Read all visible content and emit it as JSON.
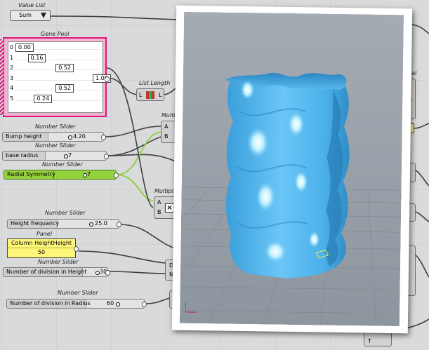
{
  "value_list": {
    "caption": "Value List",
    "selected": "Sum"
  },
  "gene_pool": {
    "caption": "Gene Pool",
    "genes": [
      {
        "index": "0",
        "value": "0.00",
        "fraction": 0.0
      },
      {
        "index": "1",
        "value": "0.16",
        "fraction": 0.16
      },
      {
        "index": "2",
        "value": "0.52",
        "fraction": 0.52
      },
      {
        "index": "3",
        "value": "1.00",
        "fraction": 1.0
      },
      {
        "index": "4",
        "value": "0.52",
        "fraction": 0.52
      },
      {
        "index": "5",
        "value": "0.24",
        "fraction": 0.24
      }
    ]
  },
  "list_length": {
    "caption": "List Length",
    "input": "L",
    "output": "L"
  },
  "multiplication_1": {
    "caption": "Multipli",
    "inputs": [
      "A",
      "B"
    ]
  },
  "multiplication_2": {
    "caption": "Multiplic",
    "inputs": [
      "A",
      "B"
    ]
  },
  "sliders": [
    {
      "caption": "Number Slider",
      "name": "Bump height",
      "value": "4.20",
      "color": "grey"
    },
    {
      "caption": "Number Slider",
      "name": "base radius",
      "value": "7",
      "color": "grey"
    },
    {
      "caption": "Number Slider",
      "name": "Radial Symmetry",
      "value": "7",
      "color": "green"
    },
    {
      "caption": "Number Slider",
      "name": "Height frequancy",
      "value": "25.0",
      "color": "grey"
    },
    {
      "caption": "Number Slider",
      "name": "Number of division in Height",
      "value": "30",
      "color": "grey"
    },
    {
      "caption": "Number Slider",
      "name": "Number of division in Radius",
      "value": "60",
      "color": "grey"
    }
  ],
  "panel": {
    "caption": "Panel",
    "title": "Column HeightHeight",
    "value": "50"
  },
  "right_side": {
    "cylindrical_caption": "ndrical",
    "pt_port": "Pt",
    "mesh_caption": "esh"
  },
  "ports_lower": {
    "d": "D",
    "n": "N",
    "t": "T"
  },
  "colors": {
    "canvas": "#d8dadb",
    "gene_pool_border": "#e0177c",
    "green_slider": "#93d13e",
    "panel_yellow": "#fff77a",
    "mesh_blue": "#55b8f0",
    "wire": "#3f3f3f",
    "green_wire": "#8bd13a"
  },
  "viewport": {
    "object": "twisted column mesh",
    "background": "#9aa2ab"
  }
}
